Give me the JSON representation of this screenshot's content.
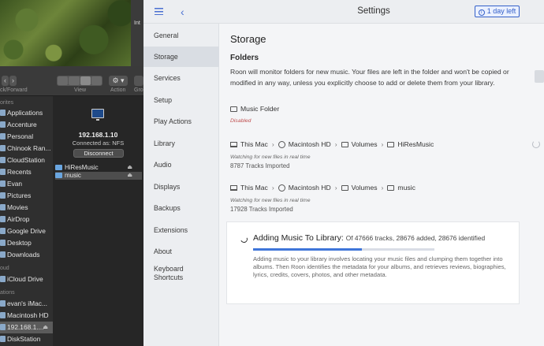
{
  "desktop": {
    "strip_label": "Int"
  },
  "finder": {
    "toolbar": {
      "back_forward_label": "ck/Forward",
      "view_label": "View",
      "action_label": "Action",
      "more_label": "Gro",
      "back_glyph": "‹",
      "forward_glyph": "›",
      "action_glyph": "⚙ ▾"
    },
    "sidebar": {
      "favorites_heading": "orites",
      "favorites": [
        "Applications",
        "Accenture",
        "Personal",
        "Chinook Ran...",
        "CloudStation",
        "Recents",
        "Evan",
        "Pictures",
        "Movies",
        "AirDrop",
        "Google Drive",
        "Desktop",
        "Downloads"
      ],
      "icloud_heading": "oud",
      "icloud": [
        "iCloud Drive"
      ],
      "locations_heading": "ations",
      "locations": [
        "evan's iMac...",
        "Macintosh HD",
        "192.168.1....",
        "DiskStation"
      ],
      "selected_location_index": 2
    },
    "server": {
      "ip": "192.168.1.10",
      "connected_as": "Connected as: NFS",
      "disconnect_label": "Disconnect",
      "shares": [
        "HiResMusic",
        "music"
      ],
      "selected_share_index": 1
    }
  },
  "roon": {
    "header": {
      "title": "Settings",
      "trial_label": "1 day left",
      "back_glyph": "‹",
      "info_glyph": "i"
    },
    "nav": [
      "General",
      "Storage",
      "Services",
      "Setup",
      "Play Actions",
      "Library",
      "Audio",
      "Displays",
      "Backups",
      "Extensions",
      "About",
      "Keyboard",
      "Shortcuts"
    ],
    "selected_nav": "Storage",
    "storage": {
      "title": "Storage",
      "folders_heading": "Folders",
      "description": "Roon will monitor folders for new music. Your files are left in the folder and won't be copied or modified in any way, unless you explicitly choose to add or delete them from your library.",
      "music_folder": {
        "label": "Music Folder",
        "status": "Disabled"
      },
      "watched_folders": [
        {
          "path": [
            "This Mac",
            "Macintosh HD",
            "Volumes",
            "HiResMusic"
          ],
          "note": "Watching for new files in real time",
          "count": "8787 Tracks Imported"
        },
        {
          "path": [
            "This Mac",
            "Macintosh HD",
            "Volumes",
            "music"
          ],
          "note": "Watching for new files in real time",
          "count": "17928 Tracks Imported"
        }
      ]
    },
    "import": {
      "title": "Adding Music To Library:",
      "stats": "Of 47666 tracks, 28676 added, 28676 identified",
      "progress": 0.602,
      "description": "Adding music to your library involves locating your music files and clumping them together into albums. Then Roon identifies the metadata for your albums, and retrieves reviews, biographies, lyrics, credits, covers, photos, and other metadata."
    },
    "colors": {
      "accent": "#3f75d9",
      "disabled": "#c05050"
    }
  }
}
